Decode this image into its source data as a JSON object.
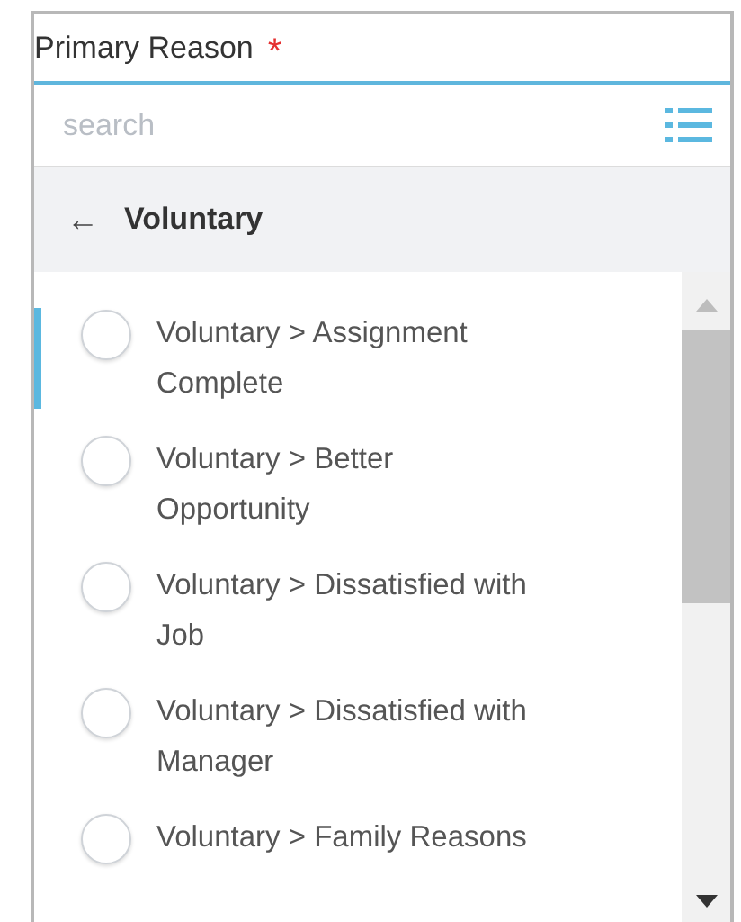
{
  "field": {
    "label": "Primary Reason",
    "required_mark": "*"
  },
  "search": {
    "placeholder": "search"
  },
  "back": {
    "arrow": "←",
    "label": "Voluntary"
  },
  "options": [
    {
      "label": "Voluntary > Assignment Complete",
      "checked": false,
      "highlighted": true
    },
    {
      "label": "Voluntary > Better Opportunity",
      "checked": false,
      "highlighted": false
    },
    {
      "label": "Voluntary > Dissatisfied with Job",
      "checked": false,
      "highlighted": false
    },
    {
      "label": "Voluntary > Dissatisfied with Manager",
      "checked": false,
      "highlighted": false
    },
    {
      "label": "Voluntary > Family Reasons",
      "checked": false,
      "highlighted": false
    }
  ]
}
